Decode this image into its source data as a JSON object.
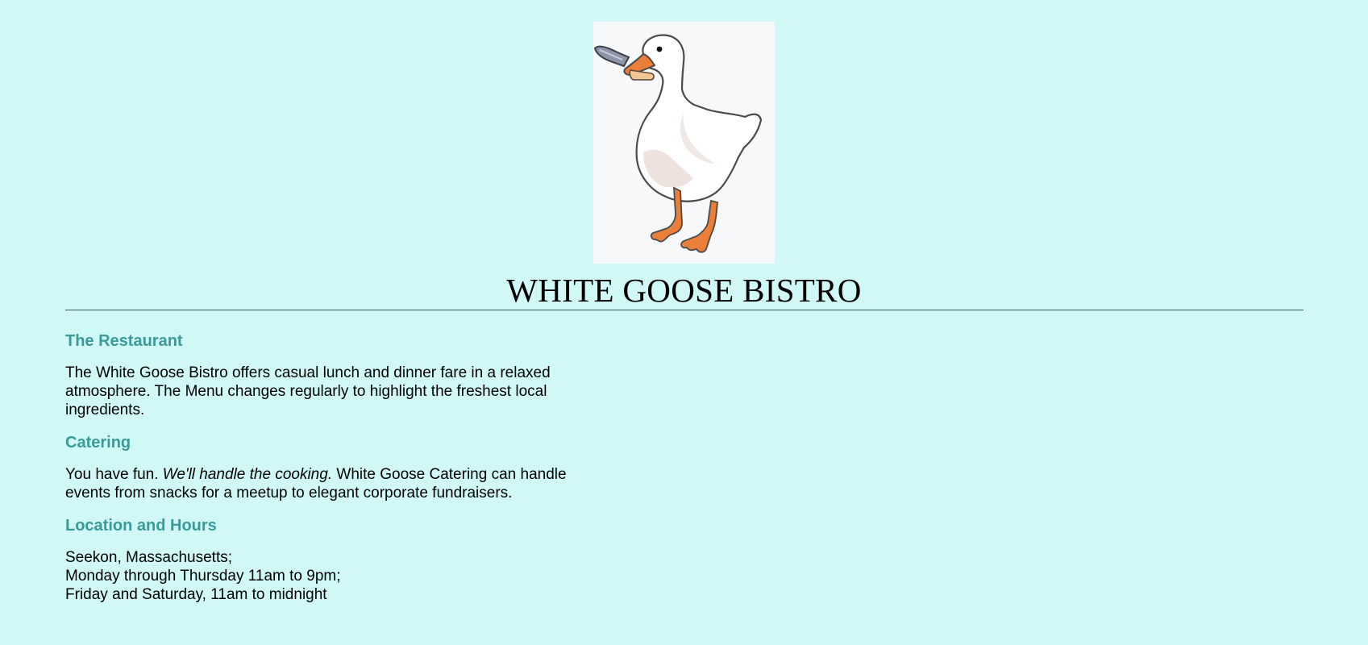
{
  "header": {
    "logo_name": "white-goose-with-knife-logo",
    "title": "WHITE GOOSE BISTRO"
  },
  "sections": {
    "restaurant": {
      "heading": "The Restaurant",
      "text": "The White Goose Bistro offers casual lunch and dinner fare in a relaxed atmosphere. The Menu changes regularly to highlight the freshest local ingredients."
    },
    "catering": {
      "heading": "Catering",
      "text_before": "You have fun.",
      "emphasis": "We'll handle the cooking.",
      "text_after": "White Goose Catering can handle events from snacks for a meetup to elegant corporate fundraisers."
    },
    "location": {
      "heading": "Location and Hours",
      "lines": [
        "Seekon, Massachusetts;",
        "Monday through Thursday 11am to 9pm;",
        "Friday and Saturday, 11am to midnight"
      ]
    }
  },
  "colors": {
    "background": "#cff8f7",
    "heading": "#3a9a99",
    "divider": "#3b5456",
    "beak_feet": "#ea7f3a"
  }
}
